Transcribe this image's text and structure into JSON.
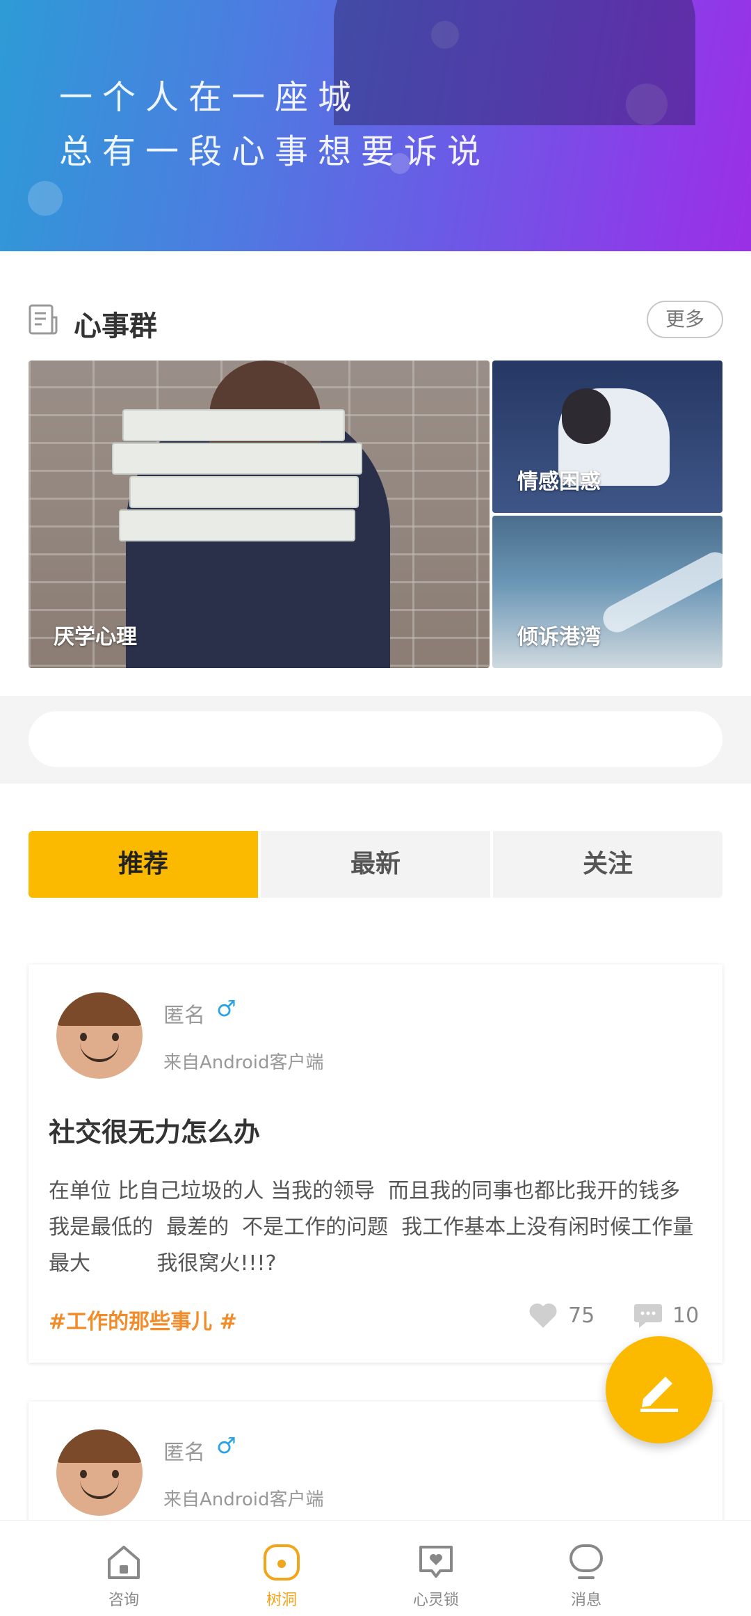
{
  "banner": {
    "line1": "一个人在一座城",
    "line2": "总有一段心事想要诉说"
  },
  "section": {
    "title": "心事群",
    "more_label": "更多",
    "icon": "document-icon"
  },
  "groups": [
    {
      "label": "厌学心理"
    },
    {
      "label": "情感困惑"
    },
    {
      "label": "倾诉港湾"
    }
  ],
  "search": {
    "placeholder": ""
  },
  "tabs": [
    {
      "label": "推荐",
      "active": true
    },
    {
      "label": "最新",
      "active": false
    },
    {
      "label": "关注",
      "active": false
    }
  ],
  "posts": [
    {
      "author": "匿名",
      "gender_symbol": "♂",
      "source": "来自Android客户端",
      "title": "社交很无力怎么办",
      "body": "在单位 比自己垃圾的人 当我的领导  而且我的同事也都比我开的钱多   我是最低的  最差的  不是工作的问题  我工作基本上没有闲时候工作量最大          我很窝火!!!?",
      "tag": "#工作的那些事儿 #",
      "likes": "75",
      "comments": "10"
    },
    {
      "author": "匿名",
      "gender_symbol": "♂",
      "source": "来自Android客户端"
    }
  ],
  "fab": {
    "icon": "pencil-icon"
  },
  "bottom_nav": [
    {
      "label": "咨询",
      "icon": "home-icon",
      "active": false
    },
    {
      "label": "树洞",
      "icon": "treehole-icon",
      "active": true
    },
    {
      "label": "心灵锁",
      "icon": "heart-chat-icon",
      "active": false
    },
    {
      "label": "消息",
      "icon": "message-bubble-icon",
      "active": false
    }
  ],
  "colors": {
    "accent": "#fbb900",
    "tag": "#f28c2a",
    "gender": "#2aa3e6"
  }
}
